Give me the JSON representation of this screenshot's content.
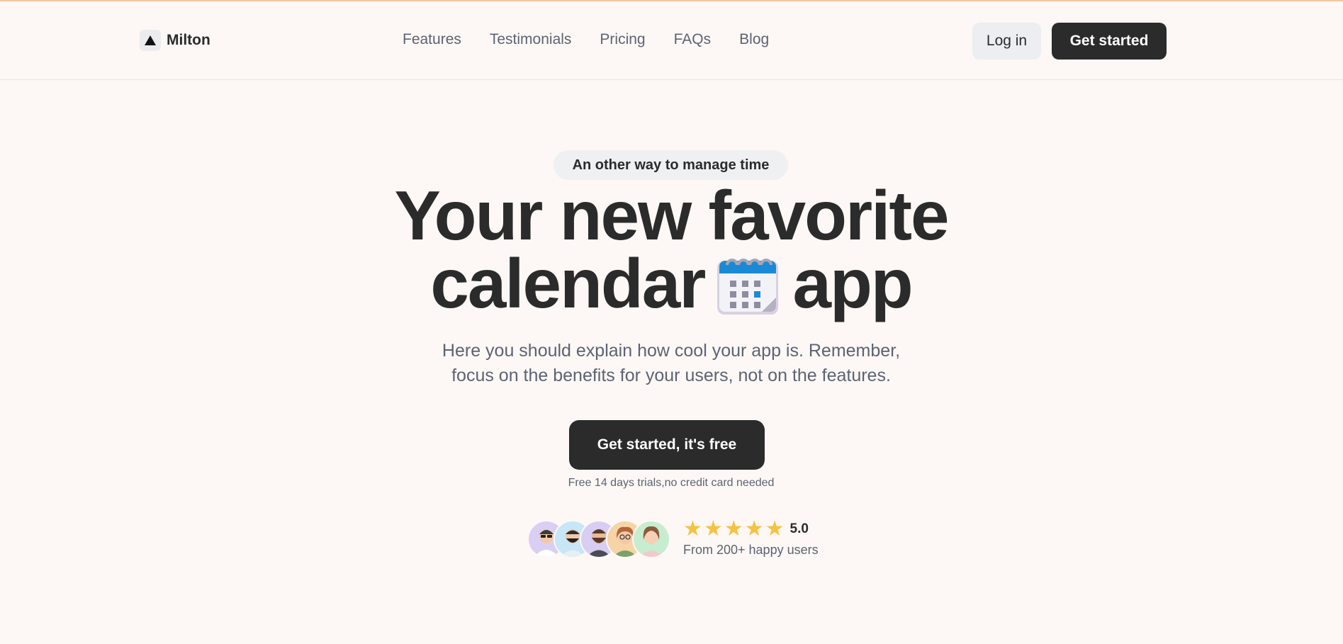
{
  "header": {
    "brand": "Milton",
    "nav": [
      "Features",
      "Testimonials",
      "Pricing",
      "FAQs",
      "Blog"
    ],
    "login": "Log in",
    "get_started": "Get started"
  },
  "hero": {
    "eyebrow": "An other way to manage time",
    "headline_line1": "Your new favorite",
    "headline_word": "calendar",
    "headline_suffix": "app",
    "subtitle_line1": "Here you should explain how cool your app is. Remember,",
    "subtitle_line2": "focus on the benefits for your users, not on the features.",
    "cta": "Get started, it's free",
    "note": "Free 14 days trials,no credit card needed"
  },
  "social_proof": {
    "stars": 5,
    "rating": "5.0",
    "users": "From 200+ happy users",
    "avatar_colors": [
      "#d9cff5",
      "#c7e6f7",
      "#d8cdf2",
      "#f6d4a6",
      "#c8ecd0"
    ]
  },
  "colors": {
    "background": "#fdf8f5",
    "dark": "#2b2b2b",
    "muted": "#5d6373",
    "star": "#f5c242",
    "accent_line": "#f0c9a0"
  },
  "icons": [
    "triangle-logo-icon",
    "calendar-emoji-icon",
    "star-icon",
    "avatar-icon"
  ]
}
